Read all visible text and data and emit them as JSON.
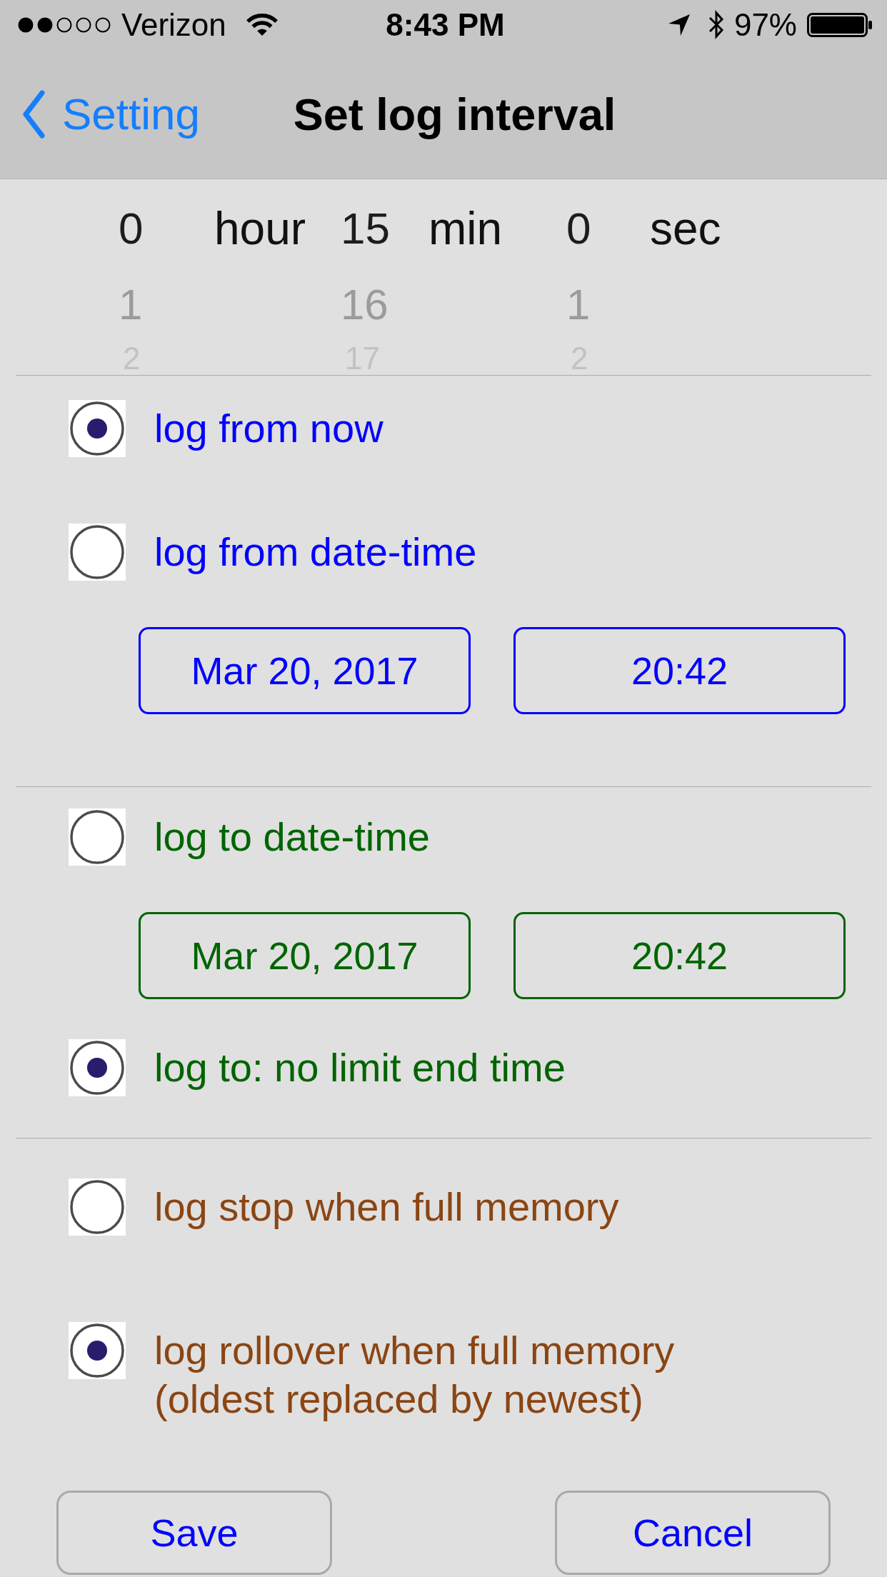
{
  "status_bar": {
    "carrier": "Verizon",
    "time": "8:43 PM",
    "battery": "97%"
  },
  "nav_bar": {
    "back_label": "Setting",
    "title": "Set log interval"
  },
  "picker": {
    "columns": [
      {
        "values": [
          {
            "label": "0",
            "selected": true
          },
          {
            "label": "1",
            "selected": false
          },
          {
            "label": "2",
            "selected": false
          }
        ],
        "unit": "hour"
      },
      {
        "values": [
          {
            "label": "15",
            "selected": true
          },
          {
            "label": "16",
            "selected": false
          },
          {
            "label": "17",
            "selected": false
          }
        ],
        "unit": "min"
      },
      {
        "values": [
          {
            "label": "0",
            "selected": true
          },
          {
            "label": "1",
            "selected": false
          },
          {
            "label": "2",
            "selected": false
          }
        ],
        "unit": "sec"
      }
    ]
  },
  "sections": [
    {
      "color": "#0000ff",
      "options": [
        {
          "kind": "plain",
          "label": "log from now",
          "selected": true
        },
        {
          "kind": "datetime",
          "label": "log from date-time",
          "selected": false,
          "date": "Mar 20, 2017",
          "time": "20:42"
        }
      ]
    },
    {
      "color": "#006400",
      "options": [
        {
          "kind": "datetime",
          "label": "log to date-time",
          "selected": false,
          "date": "Mar 20, 2017",
          "time": "20:42"
        },
        {
          "kind": "plain",
          "label": "log to: no limit end time",
          "selected": true
        }
      ]
    },
    {
      "color": "#8b4513",
      "options": [
        {
          "kind": "plain",
          "label": "log stop when full memory",
          "selected": false
        },
        {
          "kind": "plain",
          "label": "log rollover when full memory\n(oldest replaced by newest)",
          "selected": true
        }
      ]
    }
  ],
  "buttons": [
    {
      "label": "Save"
    },
    {
      "label": "Cancel"
    }
  ]
}
